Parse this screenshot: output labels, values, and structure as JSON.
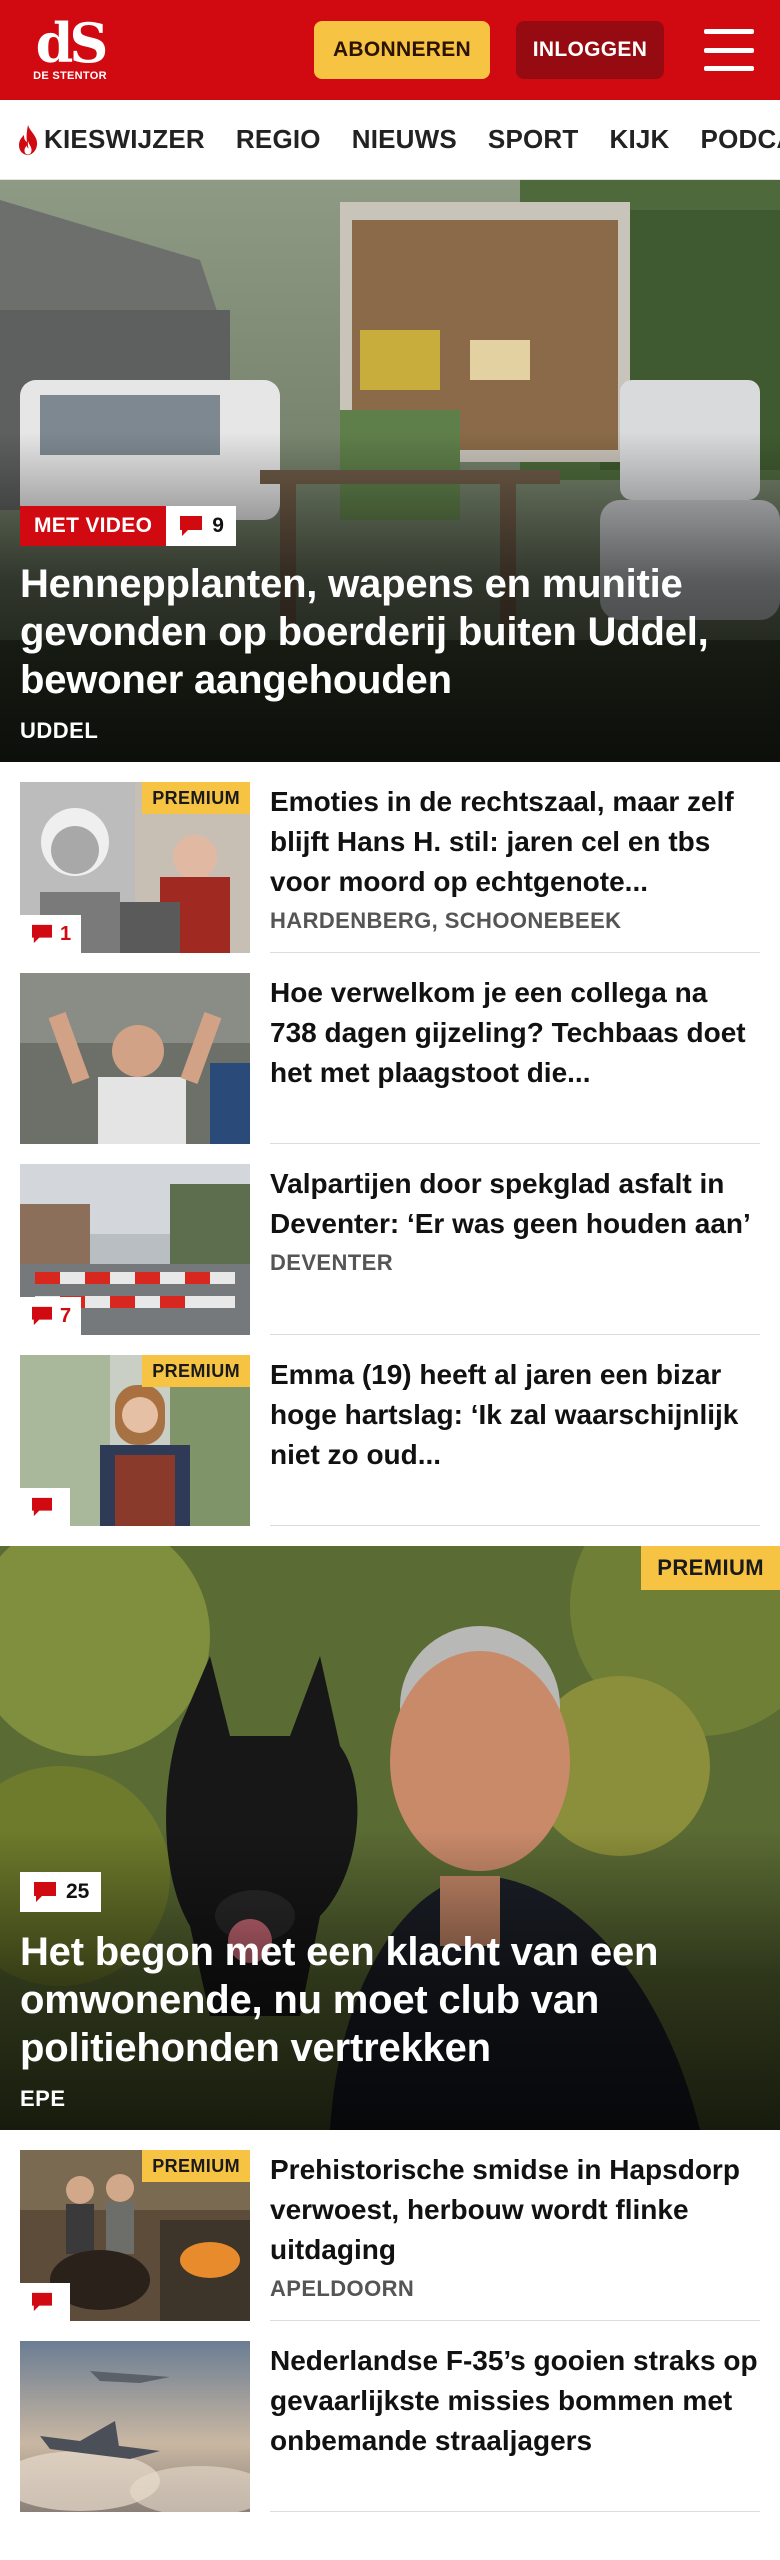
{
  "header": {
    "logo_mark": "dS",
    "logo_text": "DE STENTOR",
    "subscribe_label": "ABONNEREN",
    "login_label": "INLOGGEN",
    "menu_icon": "hamburger-icon"
  },
  "nav": {
    "items": [
      {
        "label": "KIESWIJZER",
        "icon": "flame-icon"
      },
      {
        "label": "REGIO"
      },
      {
        "label": "NIEUWS"
      },
      {
        "label": "SPORT"
      },
      {
        "label": "KIJK"
      },
      {
        "label": "PODCAS"
      }
    ]
  },
  "hero": {
    "tag": "MET VIDEO",
    "comments": "9",
    "title": "Hennepplanten, wapens en munitie gevonden op boerderij buiten Uddel, bewoner aangehouden",
    "location": "UDDEL"
  },
  "articles": [
    {
      "title": "Emoties in de rechtszaal, maar zelf blijft Hans H. stil: jaren cel en tbs voor moord op echtgenote...",
      "location": "HARDENBERG, SCHOONEBEEK",
      "premium": "PREMIUM",
      "comments": "1"
    },
    {
      "title": "Hoe verwelkom je een collega na 738 dagen gijzeling? Techbaas doet het met plaagstoot die...",
      "location": "",
      "premium": "",
      "comments": ""
    },
    {
      "title": "Valpartijen door spekglad asfalt in Deventer: ‘Er was geen houden aan’",
      "location": "DEVENTER",
      "premium": "",
      "comments": "7"
    },
    {
      "title": "Emma (19) heeft al jaren een bizar hoge hartslag: ‘Ik zal waarschijnlijk niet zo oud...",
      "location": "",
      "premium": "PREMIUM",
      "comments": ""
    }
  ],
  "feature": {
    "premium": "PREMIUM",
    "comments": "25",
    "title": "Het begon met een klacht van een omwonende, nu moet club van politiehonden vertrekken",
    "location": "EPE"
  },
  "articles2": [
    {
      "title": "Prehistorische smidse in Hapsdorp verwoest, herbouw wordt flinke uitdaging",
      "location": "APELDOORN",
      "premium": "PREMIUM",
      "comments": ""
    },
    {
      "title": "Nederlandse F-35’s gooien straks op gevaarlijkste missies bommen met onbemande straaljagers",
      "location": "",
      "premium": "",
      "comments": ""
    }
  ],
  "colors": {
    "brand_red": "#d10a11",
    "login_dark_red": "#960b11",
    "premium_yellow": "#f6c343"
  }
}
